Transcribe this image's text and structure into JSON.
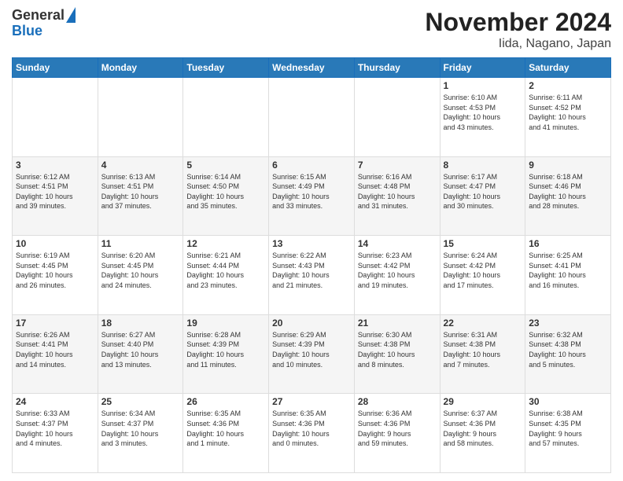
{
  "header": {
    "logo_general": "General",
    "logo_blue": "Blue",
    "title": "November 2024",
    "subtitle": "Iida, Nagano, Japan"
  },
  "days_of_week": [
    "Sunday",
    "Monday",
    "Tuesday",
    "Wednesday",
    "Thursday",
    "Friday",
    "Saturday"
  ],
  "weeks": [
    [
      {
        "day": "",
        "info": ""
      },
      {
        "day": "",
        "info": ""
      },
      {
        "day": "",
        "info": ""
      },
      {
        "day": "",
        "info": ""
      },
      {
        "day": "",
        "info": ""
      },
      {
        "day": "1",
        "info": "Sunrise: 6:10 AM\nSunset: 4:53 PM\nDaylight: 10 hours\nand 43 minutes."
      },
      {
        "day": "2",
        "info": "Sunrise: 6:11 AM\nSunset: 4:52 PM\nDaylight: 10 hours\nand 41 minutes."
      }
    ],
    [
      {
        "day": "3",
        "info": "Sunrise: 6:12 AM\nSunset: 4:51 PM\nDaylight: 10 hours\nand 39 minutes."
      },
      {
        "day": "4",
        "info": "Sunrise: 6:13 AM\nSunset: 4:51 PM\nDaylight: 10 hours\nand 37 minutes."
      },
      {
        "day": "5",
        "info": "Sunrise: 6:14 AM\nSunset: 4:50 PM\nDaylight: 10 hours\nand 35 minutes."
      },
      {
        "day": "6",
        "info": "Sunrise: 6:15 AM\nSunset: 4:49 PM\nDaylight: 10 hours\nand 33 minutes."
      },
      {
        "day": "7",
        "info": "Sunrise: 6:16 AM\nSunset: 4:48 PM\nDaylight: 10 hours\nand 31 minutes."
      },
      {
        "day": "8",
        "info": "Sunrise: 6:17 AM\nSunset: 4:47 PM\nDaylight: 10 hours\nand 30 minutes."
      },
      {
        "day": "9",
        "info": "Sunrise: 6:18 AM\nSunset: 4:46 PM\nDaylight: 10 hours\nand 28 minutes."
      }
    ],
    [
      {
        "day": "10",
        "info": "Sunrise: 6:19 AM\nSunset: 4:45 PM\nDaylight: 10 hours\nand 26 minutes."
      },
      {
        "day": "11",
        "info": "Sunrise: 6:20 AM\nSunset: 4:45 PM\nDaylight: 10 hours\nand 24 minutes."
      },
      {
        "day": "12",
        "info": "Sunrise: 6:21 AM\nSunset: 4:44 PM\nDaylight: 10 hours\nand 23 minutes."
      },
      {
        "day": "13",
        "info": "Sunrise: 6:22 AM\nSunset: 4:43 PM\nDaylight: 10 hours\nand 21 minutes."
      },
      {
        "day": "14",
        "info": "Sunrise: 6:23 AM\nSunset: 4:42 PM\nDaylight: 10 hours\nand 19 minutes."
      },
      {
        "day": "15",
        "info": "Sunrise: 6:24 AM\nSunset: 4:42 PM\nDaylight: 10 hours\nand 17 minutes."
      },
      {
        "day": "16",
        "info": "Sunrise: 6:25 AM\nSunset: 4:41 PM\nDaylight: 10 hours\nand 16 minutes."
      }
    ],
    [
      {
        "day": "17",
        "info": "Sunrise: 6:26 AM\nSunset: 4:41 PM\nDaylight: 10 hours\nand 14 minutes."
      },
      {
        "day": "18",
        "info": "Sunrise: 6:27 AM\nSunset: 4:40 PM\nDaylight: 10 hours\nand 13 minutes."
      },
      {
        "day": "19",
        "info": "Sunrise: 6:28 AM\nSunset: 4:39 PM\nDaylight: 10 hours\nand 11 minutes."
      },
      {
        "day": "20",
        "info": "Sunrise: 6:29 AM\nSunset: 4:39 PM\nDaylight: 10 hours\nand 10 minutes."
      },
      {
        "day": "21",
        "info": "Sunrise: 6:30 AM\nSunset: 4:38 PM\nDaylight: 10 hours\nand 8 minutes."
      },
      {
        "day": "22",
        "info": "Sunrise: 6:31 AM\nSunset: 4:38 PM\nDaylight: 10 hours\nand 7 minutes."
      },
      {
        "day": "23",
        "info": "Sunrise: 6:32 AM\nSunset: 4:38 PM\nDaylight: 10 hours\nand 5 minutes."
      }
    ],
    [
      {
        "day": "24",
        "info": "Sunrise: 6:33 AM\nSunset: 4:37 PM\nDaylight: 10 hours\nand 4 minutes."
      },
      {
        "day": "25",
        "info": "Sunrise: 6:34 AM\nSunset: 4:37 PM\nDaylight: 10 hours\nand 3 minutes."
      },
      {
        "day": "26",
        "info": "Sunrise: 6:35 AM\nSunset: 4:36 PM\nDaylight: 10 hours\nand 1 minute."
      },
      {
        "day": "27",
        "info": "Sunrise: 6:35 AM\nSunset: 4:36 PM\nDaylight: 10 hours\nand 0 minutes."
      },
      {
        "day": "28",
        "info": "Sunrise: 6:36 AM\nSunset: 4:36 PM\nDaylight: 9 hours\nand 59 minutes."
      },
      {
        "day": "29",
        "info": "Sunrise: 6:37 AM\nSunset: 4:36 PM\nDaylight: 9 hours\nand 58 minutes."
      },
      {
        "day": "30",
        "info": "Sunrise: 6:38 AM\nSunset: 4:35 PM\nDaylight: 9 hours\nand 57 minutes."
      }
    ]
  ]
}
